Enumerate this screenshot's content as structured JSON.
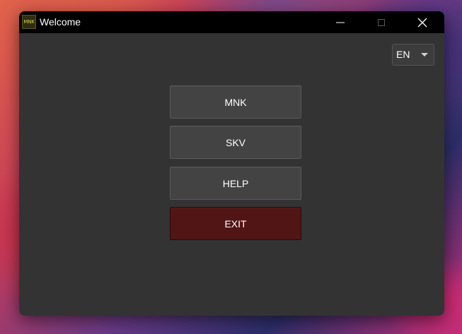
{
  "window": {
    "title": "Welcome",
    "app_icon_text": "MNK"
  },
  "language": {
    "selected": "EN"
  },
  "menu": {
    "mnk_label": "MNK",
    "skv_label": "SKV",
    "help_label": "HELP",
    "exit_label": "EXIT"
  },
  "colors": {
    "window_bg": "#333333",
    "titlebar_bg": "#000000",
    "button_bg": "#434343",
    "exit_button_bg": "#521515"
  },
  "icons": {
    "minimize": "minimize-icon",
    "maximize": "maximize-icon",
    "close": "close-icon",
    "dropdown": "chevron-down-icon"
  }
}
